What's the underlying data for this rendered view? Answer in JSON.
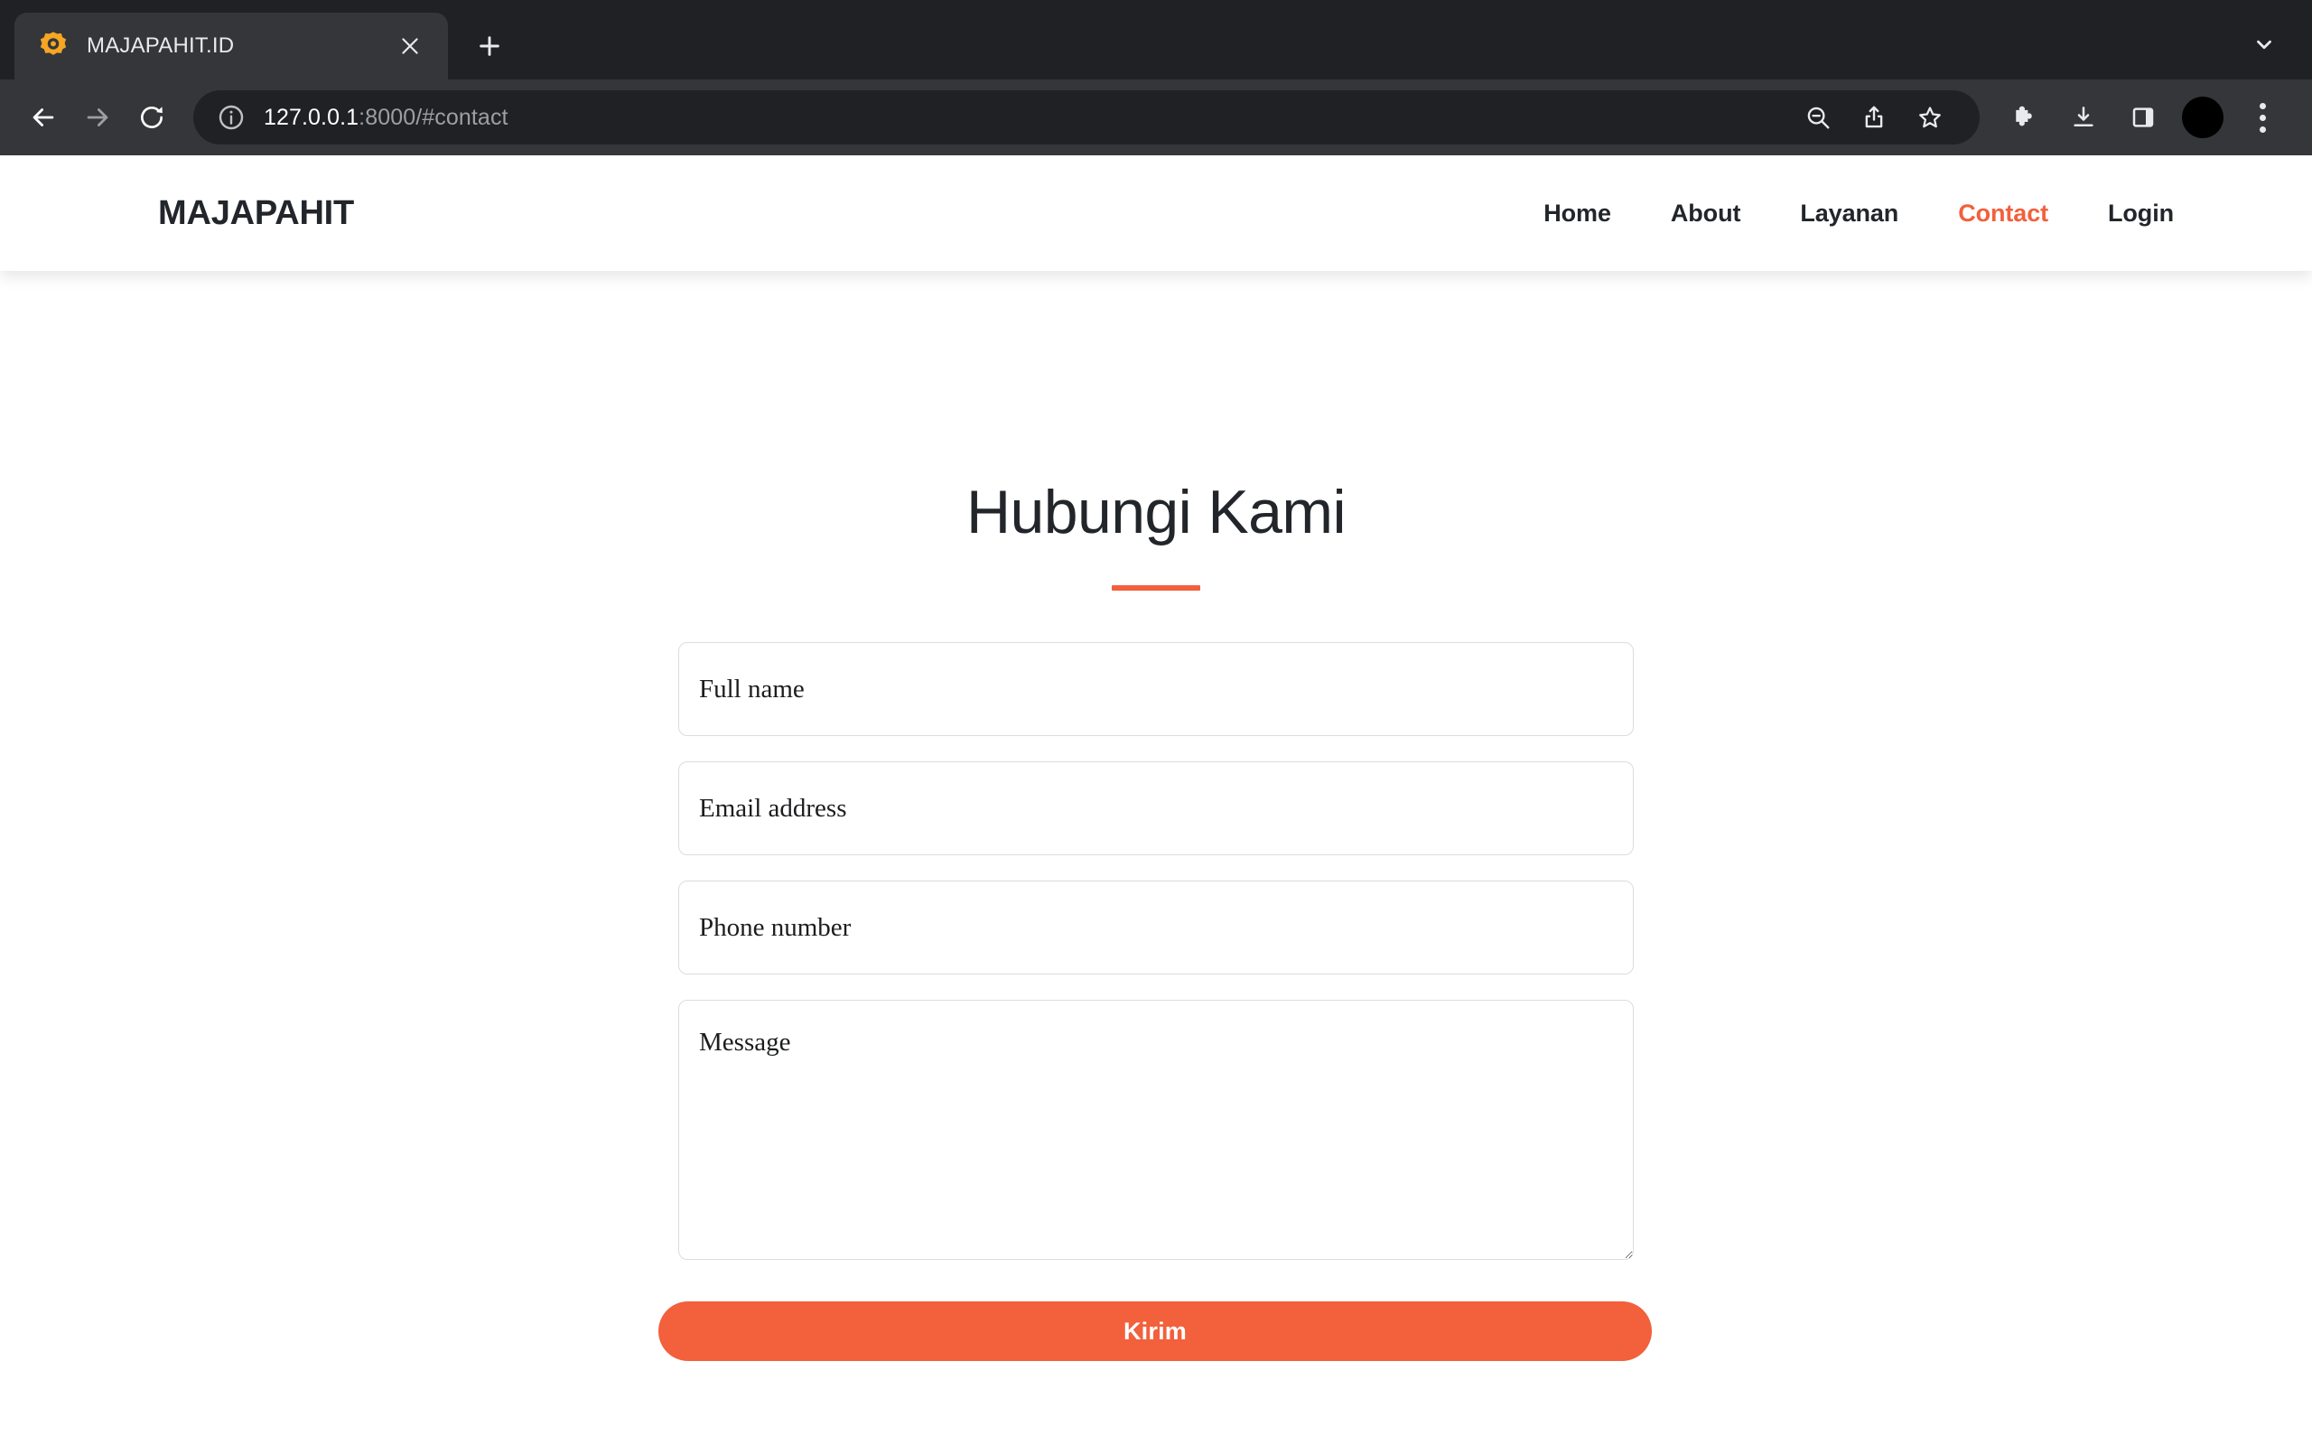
{
  "browser": {
    "tab": {
      "title": "MAJAPAHIT.ID",
      "favicon": "star-burst-icon",
      "close_label": "×",
      "new_tab_label": "+"
    },
    "tab_search_icon": "chevron-down-icon",
    "toolbar": {
      "back_icon": "back-arrow-icon",
      "forward_icon": "forward-arrow-icon",
      "reload_icon": "reload-icon",
      "security_icon": "info-circle-icon",
      "url_host": "127.0.0.1",
      "url_rest": ":8000/#contact",
      "url_full": "127.0.0.1:8000/#contact",
      "actions": [
        {
          "name": "zoom-out-icon",
          "label": "Zoom out"
        },
        {
          "name": "share-icon",
          "label": "Share"
        },
        {
          "name": "bookmark-star-icon",
          "label": "Bookmark"
        }
      ],
      "extras": [
        {
          "name": "extensions-puzzle-icon",
          "label": "Extensions"
        },
        {
          "name": "downloads-icon",
          "label": "Downloads"
        },
        {
          "name": "side-panel-icon",
          "label": "Side panel"
        },
        {
          "name": "profile-avatar",
          "label": "Profile"
        },
        {
          "name": "kebab-menu-icon",
          "label": "Customize and control"
        }
      ]
    }
  },
  "site": {
    "brand": "MAJAPAHIT",
    "nav": [
      {
        "label": "Home",
        "active": false
      },
      {
        "label": "About",
        "active": false
      },
      {
        "label": "Layanan",
        "active": false
      },
      {
        "label": "Contact",
        "active": true
      },
      {
        "label": "Login",
        "active": false
      }
    ],
    "accent_color": "#F2603C",
    "text_color": "#22262b"
  },
  "main": {
    "title": "Hubungi Kami",
    "form": {
      "fields": [
        {
          "name": "full-name",
          "placeholder": "Full name",
          "value": ""
        },
        {
          "name": "email",
          "placeholder": "Email address",
          "value": ""
        },
        {
          "name": "phone",
          "placeholder": "Phone number",
          "value": ""
        }
      ],
      "message": {
        "name": "message",
        "placeholder": "Message",
        "value": ""
      },
      "submit_label": "Kirim"
    }
  }
}
